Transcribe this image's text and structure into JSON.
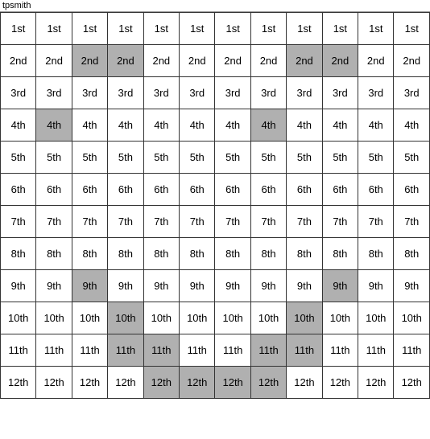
{
  "title": "tpsmith",
  "cols": 12,
  "rows": 12,
  "labels": [
    "1st",
    "2nd",
    "3rd",
    "4th",
    "5th",
    "6th",
    "7th",
    "8th",
    "9th",
    "10th",
    "11th",
    "12th"
  ],
  "highlights": [
    [
      false,
      false,
      false,
      false,
      false,
      false,
      false,
      false,
      false,
      false,
      false,
      false
    ],
    [
      false,
      false,
      true,
      true,
      false,
      false,
      false,
      false,
      true,
      true,
      false,
      false
    ],
    [
      false,
      false,
      false,
      false,
      false,
      false,
      false,
      false,
      false,
      false,
      false,
      false
    ],
    [
      false,
      true,
      false,
      false,
      false,
      false,
      false,
      true,
      false,
      false,
      false,
      false
    ],
    [
      false,
      false,
      false,
      false,
      false,
      false,
      false,
      false,
      false,
      false,
      false,
      false
    ],
    [
      false,
      false,
      false,
      false,
      false,
      false,
      false,
      false,
      false,
      false,
      false,
      false
    ],
    [
      false,
      false,
      false,
      false,
      false,
      false,
      false,
      false,
      false,
      false,
      false,
      false
    ],
    [
      false,
      false,
      false,
      false,
      false,
      false,
      false,
      false,
      false,
      false,
      false,
      false
    ],
    [
      false,
      false,
      true,
      false,
      false,
      false,
      false,
      false,
      false,
      true,
      false,
      false
    ],
    [
      false,
      false,
      false,
      true,
      false,
      false,
      false,
      false,
      true,
      false,
      false,
      false
    ],
    [
      false,
      false,
      false,
      true,
      true,
      false,
      false,
      true,
      true,
      false,
      false,
      false
    ],
    [
      false,
      false,
      false,
      false,
      true,
      true,
      true,
      true,
      false,
      false,
      false,
      false
    ]
  ]
}
